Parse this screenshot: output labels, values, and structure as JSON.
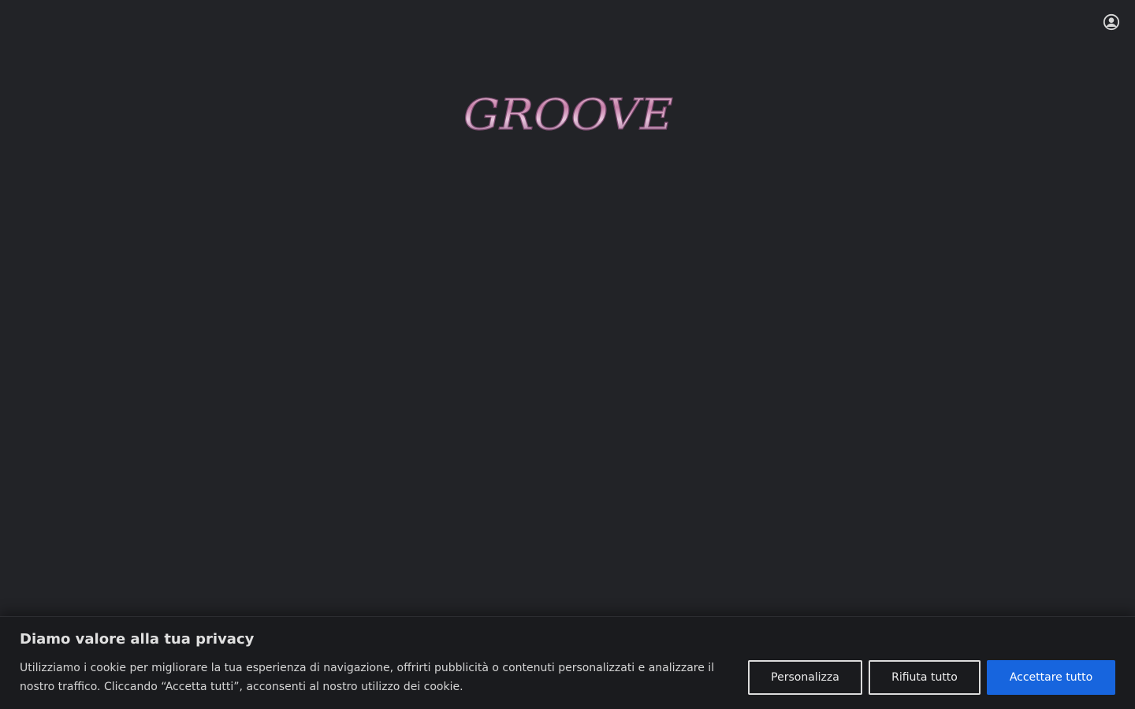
{
  "header": {
    "account_icon": "user-circle-icon"
  },
  "logo": {
    "text": "GROOVE",
    "colors": {
      "fill": "#c77fa8",
      "highlight": "#e8c6dd",
      "shadow": "#7a4a6e"
    }
  },
  "cookie_banner": {
    "title": "Diamo valore alla tua privacy",
    "text": "Utilizziamo i cookie per migliorare la tua esperienza di navigazione, offrirti pubblicità o contenuti personalizzati e analizzare il nostro traffico. Cliccando “Accetta tutti”, acconsenti al nostro utilizzo dei cookie.",
    "buttons": {
      "customize": "Personalizza",
      "reject": "Rifiuta tutto",
      "accept": "Accettare tutto"
    },
    "colors": {
      "background": "#1a1b1e",
      "accent": "#1765de"
    }
  },
  "page": {
    "background": "#222327"
  }
}
